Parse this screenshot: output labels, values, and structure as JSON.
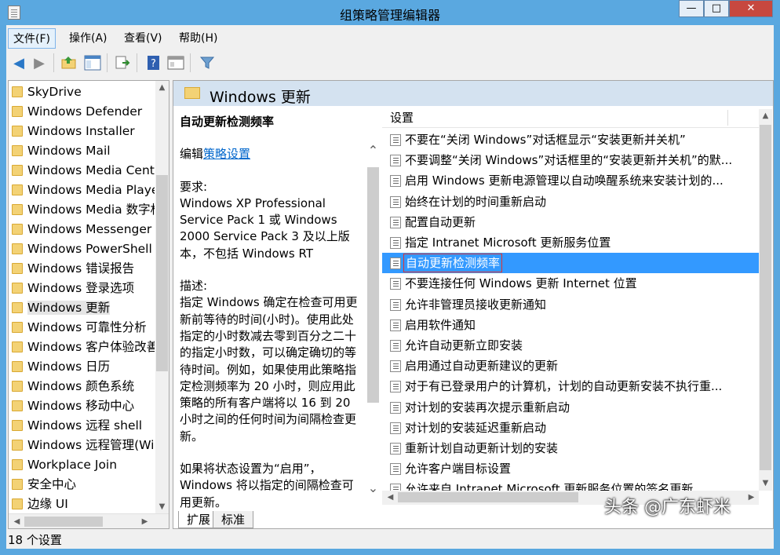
{
  "window": {
    "title": "组策略管理编辑器",
    "close_label": "✕",
    "max_label": "□",
    "min_label": "—"
  },
  "menu": [
    {
      "label": "文件(F)"
    },
    {
      "label": "操作(A)"
    },
    {
      "label": "查看(V)"
    },
    {
      "label": "帮助(H)"
    }
  ],
  "toolbar": {
    "icons": [
      "back-icon",
      "forward-icon",
      "up-folder-icon",
      "show-hide-tree-icon",
      "export-list-icon",
      "help-icon",
      "properties-icon",
      "filter-icon"
    ]
  },
  "tree": {
    "items": [
      {
        "label": "SkyDrive"
      },
      {
        "label": "Windows Defender"
      },
      {
        "label": "Windows Installer"
      },
      {
        "label": "Windows Mail"
      },
      {
        "label": "Windows Media Cente"
      },
      {
        "label": "Windows Media Playe"
      },
      {
        "label": "Windows Media 数字权"
      },
      {
        "label": "Windows Messenger"
      },
      {
        "label": "Windows PowerShell"
      },
      {
        "label": "Windows 错误报告"
      },
      {
        "label": "Windows 登录选项"
      },
      {
        "label": "Windows 更新"
      },
      {
        "label": "Windows 可靠性分析"
      },
      {
        "label": "Windows 客户体验改善"
      },
      {
        "label": "Windows 日历"
      },
      {
        "label": "Windows 颜色系统"
      },
      {
        "label": "Windows 移动中心"
      },
      {
        "label": "Windows 远程 shell"
      },
      {
        "label": "Windows 远程管理(Win"
      },
      {
        "label": "Workplace Join"
      },
      {
        "label": "安全中心"
      },
      {
        "label": "边缘 UI"
      }
    ],
    "selected_index": 11
  },
  "main": {
    "title": "Windows 更新",
    "desc": {
      "heading": "自动更新检测频率",
      "edit_prefix": "编辑",
      "edit_link": "策略设置",
      "req_label": "要求:",
      "req_text": "Windows XP Professional Service Pack 1 或 Windows 2000 Service Pack 3 及以上版本，不包括 Windows RT",
      "desc_label": "描述:",
      "desc_text": "指定 Windows 确定在检查可用更新前等待的时间(小时)。使用此处指定的小时数减去零到百分之二十的指定小时数，可以确定确切的等待时间。例如，如果使用此策略指定检测频率为 20 小时，则应用此策略的所有客户端将以 16 到 20 小时之间的任何时间为间隔检查更新。",
      "more_text": "如果将状态设置为“启用”，Windows 将以指定的间隔检查可用更新。"
    },
    "list_header": "设置",
    "rows": [
      {
        "label": "不要在“关闭 Windows”对话框显示“安装更新并关机”"
      },
      {
        "label": "不要调整“关闭 Windows”对话框里的“安装更新并关机”的默..."
      },
      {
        "label": "启用 Windows 更新电源管理以自动唤醒系统来安装计划的..."
      },
      {
        "label": "始终在计划的时间重新启动"
      },
      {
        "label": "配置自动更新"
      },
      {
        "label": "指定 Intranet Microsoft 更新服务位置"
      },
      {
        "label": "自动更新检测频率"
      },
      {
        "label": "不要连接任何 Windows 更新 Internet 位置"
      },
      {
        "label": "允许非管理员接收更新通知"
      },
      {
        "label": "启用软件通知"
      },
      {
        "label": "允许自动更新立即安装"
      },
      {
        "label": "启用通过自动更新建议的更新"
      },
      {
        "label": "对于有已登录用户的计算机，计划的自动更新安装不执行重..."
      },
      {
        "label": "对计划的安装再次提示重新启动"
      },
      {
        "label": "对计划的安装延迟重新启动"
      },
      {
        "label": "重新计划自动更新计划的安装"
      },
      {
        "label": "允许客户端目标设置"
      },
      {
        "label": "允许来自 Intranet Microsoft 更新服务位置的签名更新"
      }
    ],
    "selected_row": 6,
    "tabs": [
      {
        "label": "扩展"
      },
      {
        "label": "标准"
      }
    ]
  },
  "status": {
    "text": "18 个设置"
  },
  "watermark": {
    "text": "头条 @广东虾米"
  }
}
